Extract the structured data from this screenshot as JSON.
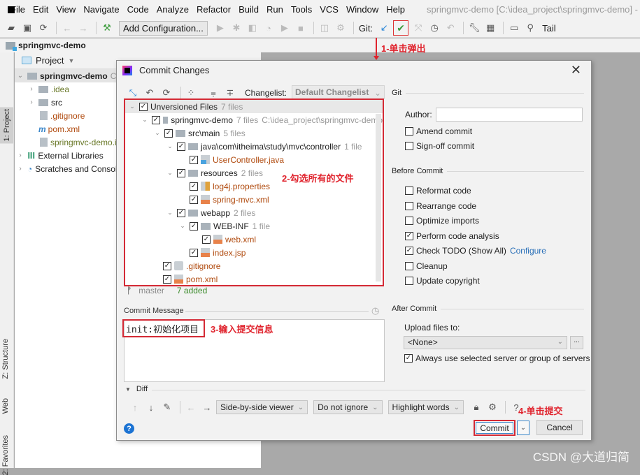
{
  "menubar": {
    "items": [
      "File",
      "Edit",
      "View",
      "Navigate",
      "Code",
      "Analyze",
      "Refactor",
      "Build",
      "Run",
      "Tools",
      "VCS",
      "Window",
      "Help"
    ],
    "title": "springmvc-demo [C:\\idea_project\\springmvc-demo] - IntelliJ IDEA"
  },
  "toolbar": {
    "add_configuration": "Add Configuration...",
    "git_label": "Git:",
    "tail_label": "Tail"
  },
  "project_bar": {
    "name": "springmvc-demo"
  },
  "left_strip": {
    "project_tab": "1: Project",
    "structure_tab": "Z: Structure",
    "web_tab": "Web",
    "favorites_tab": "2: Favorites"
  },
  "project_panel": {
    "header": "Project",
    "items": [
      {
        "label": "springmvc-demo",
        "suffix": "C:\\"
      },
      {
        "label": ".idea"
      },
      {
        "label": "src"
      },
      {
        "label": ".gitignore"
      },
      {
        "label": "pom.xml"
      },
      {
        "label": "springmvc-demo.iml"
      },
      {
        "label": "External Libraries"
      },
      {
        "label": "Scratches and Consoles"
      }
    ]
  },
  "dialog": {
    "title": "Commit Changes",
    "changelist_label": "Changelist:",
    "changelist_value": "Default Changelist",
    "tree": [
      {
        "name": "Unversioned Files",
        "count": "7 files"
      },
      {
        "name": "springmvc-demo",
        "count": "7 files",
        "path": "C:\\idea_project\\springmvc-demo"
      },
      {
        "name": "src\\main",
        "count": "5 files"
      },
      {
        "name": "java\\com\\itheima\\study\\mvc\\controller",
        "count": "1 file"
      },
      {
        "name": "UserController.java"
      },
      {
        "name": "resources",
        "count": "2 files"
      },
      {
        "name": "log4j.properties"
      },
      {
        "name": "spring-mvc.xml"
      },
      {
        "name": "webapp",
        "count": "2 files"
      },
      {
        "name": "WEB-INF",
        "count": "1 file"
      },
      {
        "name": "web.xml"
      },
      {
        "name": "index.jsp"
      },
      {
        "name": ".gitignore"
      },
      {
        "name": "pom.xml"
      }
    ],
    "branch": "master",
    "added": "7 added",
    "commit_message_label": "Commit Message",
    "commit_message": "init:初始化项目",
    "diff_label": "Diff",
    "diff_viewer": "Side-by-side viewer",
    "diff_ignore": "Do not ignore",
    "diff_highlight": "Highlight words",
    "diff_help": "?",
    "help": "?",
    "commit_button": "Commit",
    "cancel_button": "Cancel",
    "git_section": "Git",
    "author_label": "Author:",
    "author_value": "",
    "amend_commit": "Amend commit",
    "signoff_commit": "Sign-off commit",
    "before_commit_section": "Before Commit",
    "before_commit": [
      {
        "label": "Reformat code",
        "checked": false
      },
      {
        "label": "Rearrange code",
        "checked": false
      },
      {
        "label": "Optimize imports",
        "checked": false
      },
      {
        "label": "Perform code analysis",
        "checked": true
      },
      {
        "label": "Check TODO (Show All)",
        "checked": true,
        "link": "Configure"
      },
      {
        "label": "Cleanup",
        "checked": false
      },
      {
        "label": "Update copyright",
        "checked": false
      }
    ],
    "after_commit_section": "After Commit",
    "upload_label": "Upload files to:",
    "upload_value": "<None>",
    "upload_more": "...",
    "always_use_server": "Always use selected server or group of servers"
  },
  "annotations": {
    "step1": "1-单击弹出",
    "step2": "2-勾选所有的文件",
    "step3": "3-输入提交信息",
    "step4": "4-单击提交"
  },
  "watermark": "CSDN @大道归简",
  "colors": {
    "annotation_red": "#e0232d",
    "file_orange": "#b04a0e",
    "added_green": "#3a8a2a",
    "link_blue": "#2a70b8"
  }
}
